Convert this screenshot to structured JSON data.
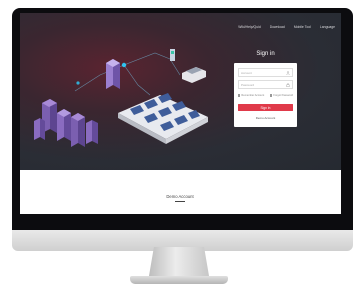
{
  "nav": {
    "items": [
      "Wiki/Help/Quid",
      "Download",
      "Mobile Tool",
      "Language"
    ]
  },
  "signin": {
    "title": "Sign in",
    "account_placeholder": "Account",
    "password_placeholder": "Password",
    "remember_label": "Remember Account",
    "forgot_label": "Forgot Password",
    "button_label": "Sign In",
    "demo_link": "Demo Account"
  },
  "tabs": {
    "demo_account": "Demo Account"
  },
  "colors": {
    "accent": "#e03a4a",
    "hero_dark": "#262a31",
    "hero_glow": "#5a2430"
  },
  "icons": [
    "user-icon",
    "lock-icon"
  ]
}
